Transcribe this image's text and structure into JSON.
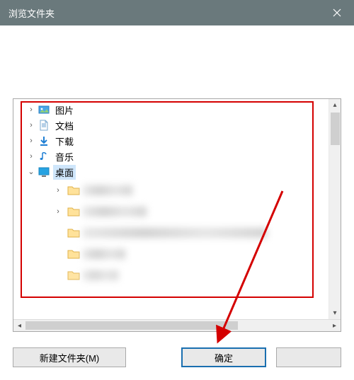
{
  "title": "浏览文件夹",
  "tree": {
    "items": [
      {
        "label": "图片",
        "icon": "pictures"
      },
      {
        "label": "文档",
        "icon": "documents"
      },
      {
        "label": "下载",
        "icon": "downloads"
      },
      {
        "label": "音乐",
        "icon": "music"
      },
      {
        "label": "桌面",
        "icon": "desktop"
      }
    ]
  },
  "buttons": {
    "new_folder": "新建文件夹(M)",
    "ok": "确定",
    "cancel": ""
  }
}
